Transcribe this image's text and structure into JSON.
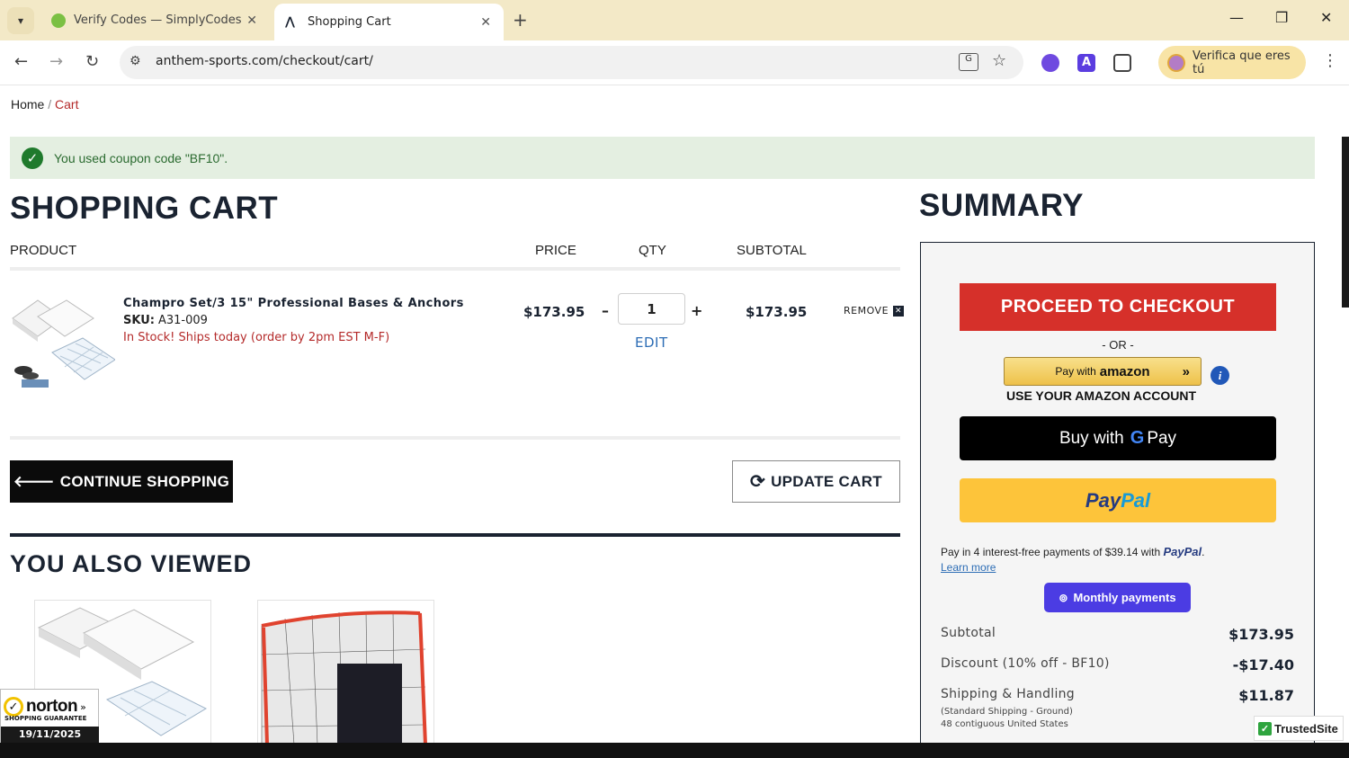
{
  "browser": {
    "tabs": [
      {
        "title": "Verify Codes — SimplyCodes",
        "active": false
      },
      {
        "title": "Shopping Cart",
        "active": true
      }
    ],
    "url": "anthem-sports.com/checkout/cart/",
    "profile_label": "Verifica que eres tú"
  },
  "breadcrumb": {
    "home": "Home",
    "separator": " / ",
    "current": "Cart"
  },
  "alert": {
    "message": "You used coupon code \"BF10\"."
  },
  "cart": {
    "heading": "SHOPPING CART",
    "columns": {
      "product": "PRODUCT",
      "price": "PRICE",
      "qty": "QTY",
      "subtotal": "SUBTOTAL"
    },
    "item": {
      "name": "Champro Set/3 15\" Professional Bases & Anchors",
      "sku_label": "SKU:",
      "sku": "A31-009",
      "stock": "In Stock! Ships today (order by 2pm EST M-F)",
      "price": "$173.95",
      "qty": "1",
      "minus": "–",
      "plus": "+",
      "edit": "EDIT",
      "subtotal": "$173.95",
      "remove": "REMOVE"
    },
    "continue_label": "CONTINUE SHOPPING",
    "update_label": "UPDATE CART"
  },
  "also_viewed": {
    "heading": "YOU ALSO VIEWED"
  },
  "norton": {
    "brand": "norton",
    "guarantee": "SHOPPING GUARANTEE",
    "date": "19/11/2025"
  },
  "summary": {
    "heading": "SUMMARY",
    "checkout_label": "PROCEED TO CHECKOUT",
    "or_label": "- OR -",
    "amazon_pay_prefix": "Pay with",
    "amazon_word": "amazon",
    "amazon_account": "USE YOUR AMAZON ACCOUNT",
    "gpay_prefix": "Buy with",
    "gpay_g": "G",
    "gpay_suffix": "Pay",
    "paypal_a": "Pay",
    "paypal_b": "Pal",
    "paylater_text": "Pay in 4 interest-free payments of $39.14 with",
    "paylater_brand": "PayPal",
    "learn_more": "Learn more",
    "monthly_label": "Monthly payments",
    "rows": [
      {
        "label": "Subtotal",
        "value": "$173.95"
      },
      {
        "label": "Discount (10% off - BF10)",
        "value": "-$17.40"
      },
      {
        "label": "Shipping & Handling",
        "value": "$11.87"
      }
    ],
    "shipping_note_1": "(Standard Shipping - Ground)",
    "shipping_note_2": "48 contiguous United States"
  },
  "trustedsite": {
    "label": "TrustedSite"
  },
  "colors": {
    "accent_red": "#d6302a",
    "navy": "#1a2331",
    "alert_bg": "#e4efe1",
    "paypal_yellow": "#fdc43a",
    "monthly_purple": "#4b3ce3"
  }
}
